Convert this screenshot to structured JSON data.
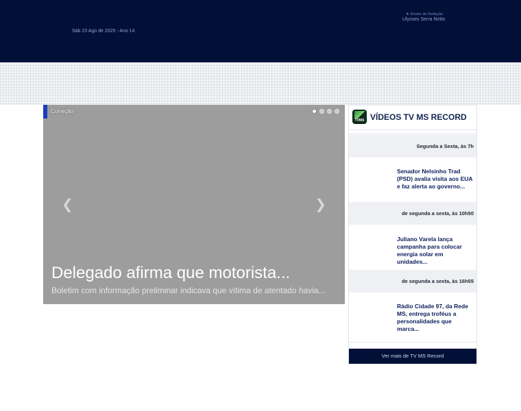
{
  "header": {
    "date": "Sáb 23 Ago de 2025 - Ano 14",
    "director_label": "★ Diretor de Redação",
    "director_name": "Ulysses Serra Netto"
  },
  "slider": {
    "category": "Correção",
    "headline": "Delegado afirma que motorista...",
    "summary": "Boletim com informação preliminar indicava que vítima de atentado havia...",
    "dots": 4,
    "active_dot": 1,
    "prev_icon": "chevron-left-icon",
    "next_icon": "chevron-right-icon"
  },
  "videos": {
    "logo_text": "TVMS",
    "title": "VÍDEOS TV MS RECORD",
    "items": [
      {
        "schedule": "Segunda a Sexta, às 7h",
        "title": "Senador Nelsinho Trad (PSD) avalia visita aos EUA e faz alerta ao governo..."
      },
      {
        "schedule": "de segunda a sexta, às 10h50",
        "title": "Juliano Varela lança campanha para colocar energia solar em unidades..."
      },
      {
        "schedule": "de segunda a sexta, às 16h55",
        "title": "Rádio Cidade 97, da Rede MS, entrega troféus a personalidades que marca..."
      }
    ],
    "more_label": "Ver mais de TV MS Record"
  },
  "colors": {
    "header_bg": "#021038",
    "accent": "#1b3cc0",
    "link": "#0c1f5c"
  }
}
